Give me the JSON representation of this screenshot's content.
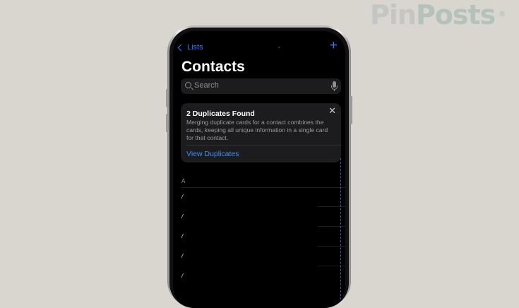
{
  "watermark": {
    "part1": "Pin",
    "part2": "Posts",
    "mark": "®"
  },
  "nav": {
    "back_label": "Lists",
    "add_label": "+"
  },
  "page": {
    "title": "Contacts"
  },
  "search": {
    "placeholder": "Search"
  },
  "duplicates_card": {
    "title": "2 Duplicates Found",
    "body": "Merging duplicate cards for a contact combines the cards, keeping all unique information in a single card for that contact.",
    "close_label": "✕",
    "link_label": "View Duplicates"
  },
  "list": {
    "section_header": "A",
    "rows": [
      "/",
      "/",
      "/",
      "/",
      "/"
    ]
  },
  "colors": {
    "accent": "#2f7cf6",
    "background": "#000000",
    "card": "#1c1c1e"
  }
}
